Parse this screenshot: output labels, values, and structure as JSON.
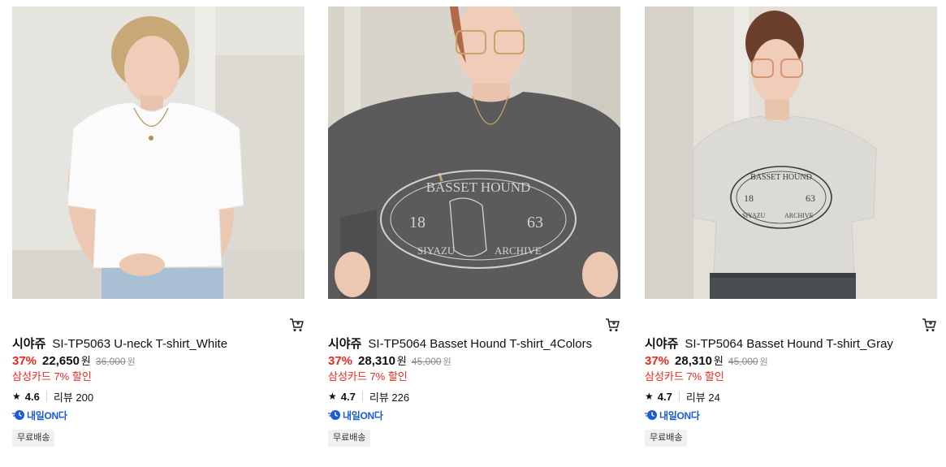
{
  "products": [
    {
      "brand": "시야쥬",
      "name": "SI-TP5063 U-neck T-shirt_White",
      "discount": "37%",
      "price": "22,650",
      "currency": "원",
      "original_price": "36,000",
      "card_promo": "삼성카드 7% 할인",
      "rating": "4.6",
      "review_label": "리뷰 200",
      "delivery": "내일ON다",
      "badge": "무료배송",
      "shirt_color": "#fbfbfb",
      "bg_color": "#e6e4df"
    },
    {
      "brand": "시야쥬",
      "name": "SI-TP5064 Basset Hound T-shirt_4Colors",
      "discount": "37%",
      "price": "28,310",
      "currency": "원",
      "original_price": "45,000",
      "card_promo": "삼성카드 7% 할인",
      "rating": "4.7",
      "review_label": "리뷰 226",
      "delivery": "내일ON다",
      "badge": "무료배송",
      "shirt_color": "#5b5b5c",
      "bg_color": "#d8d4cc"
    },
    {
      "brand": "시야쥬",
      "name": "SI-TP5064 Basset Hound T-shirt_Gray",
      "discount": "37%",
      "price": "28,310",
      "currency": "원",
      "original_price": "45,000",
      "card_promo": "삼성카드 7% 할인",
      "rating": "4.7",
      "review_label": "리뷰 24",
      "delivery": "내일ON다",
      "badge": "무료배송",
      "shirt_color": "#dcdad4",
      "bg_color": "#e3e0da"
    }
  ],
  "graphic": {
    "top_text": "BASSET HOUND",
    "year_left": "18",
    "year_right": "63",
    "bottom_left": "SIYAZU",
    "bottom_right": "ARCHIVE"
  },
  "colors": {
    "accent_red": "#f2261a",
    "delivery_blue": "#1a5bd6"
  }
}
